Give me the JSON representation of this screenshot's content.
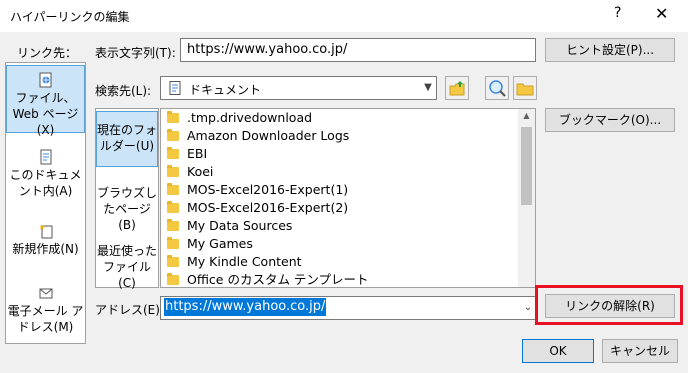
{
  "window": {
    "title": "ハイパーリンクの編集",
    "help_icon": "?",
    "close_icon": "✕"
  },
  "link_to_label": "リンク先：",
  "sidebar": {
    "items": [
      {
        "label": "ファイル、Web ページ(X)",
        "icon": "web-page-icon",
        "selected": true
      },
      {
        "label": "このドキュメント内(A)",
        "icon": "document-icon",
        "selected": false
      },
      {
        "label": "新規作成(N)",
        "icon": "new-document-icon",
        "selected": false
      },
      {
        "label": "電子メール アドレス(M)",
        "icon": "email-icon",
        "selected": false
      }
    ]
  },
  "display_text": {
    "label": "表示文字列(T):",
    "value": "https://www.yahoo.co.jp/"
  },
  "search_in": {
    "label": "検索先(L):",
    "value": "ドキュメント"
  },
  "nav": {
    "items": [
      {
        "label": "現在のフォルダー(U)",
        "selected": true
      },
      {
        "label": "ブラウズしたページ(B)",
        "selected": false
      },
      {
        "label": "最近使ったファイル(C)",
        "selected": false
      }
    ]
  },
  "files": [
    ".tmp.drivedownload",
    "Amazon Downloader Logs",
    "EBI",
    "Koei",
    "MOS-Excel2016-Expert(1)",
    "MOS-Excel2016-Expert(2)",
    "My Data Sources",
    "My Games",
    "My Kindle Content",
    "Office のカスタム テンプレート"
  ],
  "address": {
    "label": "アドレス(E):",
    "value": "https://www.yahoo.co.jp/"
  },
  "buttons": {
    "screentip": "ヒント設定(P)...",
    "bookmark": "ブックマーク(O)...",
    "remove_link": "リンクの解除(R)",
    "ok": "OK",
    "cancel": "キャンセル"
  },
  "colors": {
    "selection": "#cce4f7",
    "highlight_box": "#e81123",
    "address_selection": "#0078d7"
  }
}
